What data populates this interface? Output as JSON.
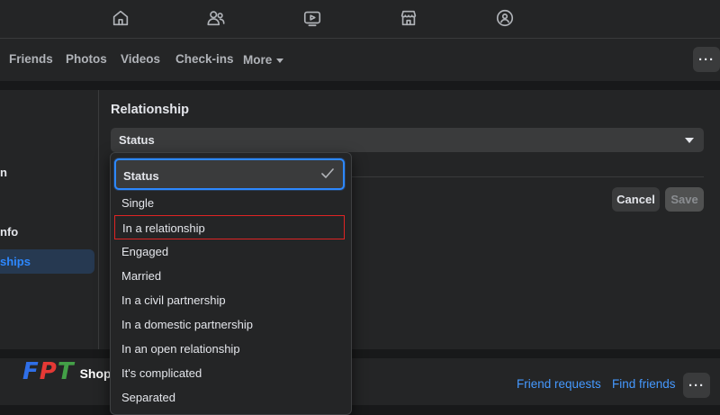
{
  "topnav": {
    "icons": [
      "home-icon",
      "friends-icon",
      "watch-icon",
      "marketplace-icon",
      "groups-icon"
    ]
  },
  "tabs": [
    {
      "label": "Friends"
    },
    {
      "label": "Photos"
    },
    {
      "label": "Videos"
    },
    {
      "label": "Check-ins"
    },
    {
      "label": "More"
    }
  ],
  "more_button": {
    "label": "···"
  },
  "left_nav": {
    "items": [
      {
        "label": "n"
      },
      {
        "label": "nfo"
      },
      {
        "label": "ships"
      }
    ]
  },
  "relationship": {
    "title": "Relationship",
    "select_value": "Status",
    "cancel_label": "Cancel",
    "save_label": "Save"
  },
  "dropdown": {
    "options": [
      "Status",
      "Single",
      "In a relationship",
      "Engaged",
      "Married",
      "In a civil partnership",
      "In a domestic partnership",
      "In an open relationship",
      "It's complicated",
      "Separated"
    ],
    "selected_index": 0,
    "highlighted_index": 2
  },
  "bottom": {
    "friend_requests": "Friend requests",
    "find_friends": "Find friends",
    "more_label": "···"
  },
  "watermark": {
    "letters": [
      "F",
      "P",
      "T"
    ],
    "text": "Shop",
    "colors": [
      "#2f6fe8",
      "#e53935",
      "#43a047"
    ]
  }
}
